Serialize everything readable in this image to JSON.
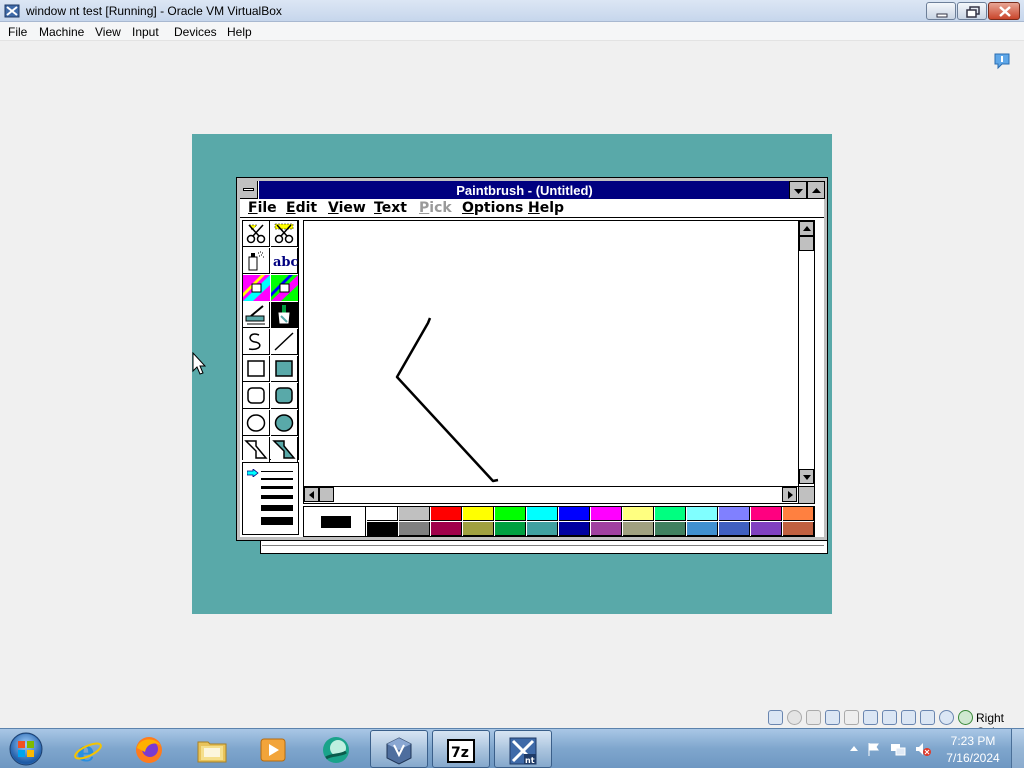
{
  "host": {
    "title": "window nt test [Running] - Oracle VM VirtualBox",
    "menu": [
      "File",
      "Machine",
      "View",
      "Input",
      "Devices",
      "Help"
    ],
    "host_key": "Right Ctrl"
  },
  "paintbrush": {
    "title": "Paintbrush - (Untitled)",
    "menu": [
      {
        "label": "File",
        "disabled": false
      },
      {
        "label": "Edit",
        "disabled": false
      },
      {
        "label": "View",
        "disabled": false
      },
      {
        "label": "Text",
        "disabled": false
      },
      {
        "label": "Pick",
        "disabled": true
      },
      {
        "label": "Options",
        "disabled": false
      },
      {
        "label": "Help",
        "disabled": false
      }
    ],
    "tools": [
      "scissors-pick",
      "scissors-cut",
      "airbrush",
      "text-abc",
      "color-eraser",
      "eraser",
      "paint-roller",
      "brush",
      "curve",
      "line",
      "box",
      "filled-box",
      "rounded-box",
      "filled-rounded-box",
      "circle",
      "filled-circle",
      "polygon",
      "filled-polygon"
    ],
    "selected_tool": "brush",
    "foreground_color": "#000000",
    "palette_row1": [
      "#ffffff",
      "#c0c0c0",
      "#ff0000",
      "#ffff00",
      "#00ff00",
      "#00ffff",
      "#0000ff",
      "#ff00ff",
      "#ffff80",
      "#00ff80",
      "#80ffff",
      "#8080ff",
      "#ff0080",
      "#ff8040"
    ],
    "palette_row2": [
      "#000000",
      "#808080",
      "#a0004a",
      "#a0a040",
      "#00a040",
      "#40a0a0",
      "#0000a0",
      "#a040a0",
      "#a0a080",
      "#408060",
      "#4090d0",
      "#4060c0",
      "#8040c0",
      "#c06040"
    ]
  },
  "taskbar": {
    "apps": [
      "internet-explorer",
      "firefox",
      "file-explorer",
      "media-player",
      "unknown-app",
      "virtualbox",
      "7zip",
      "vm-window-nt"
    ],
    "time": "7:23 PM",
    "date": "7/16/2024"
  }
}
